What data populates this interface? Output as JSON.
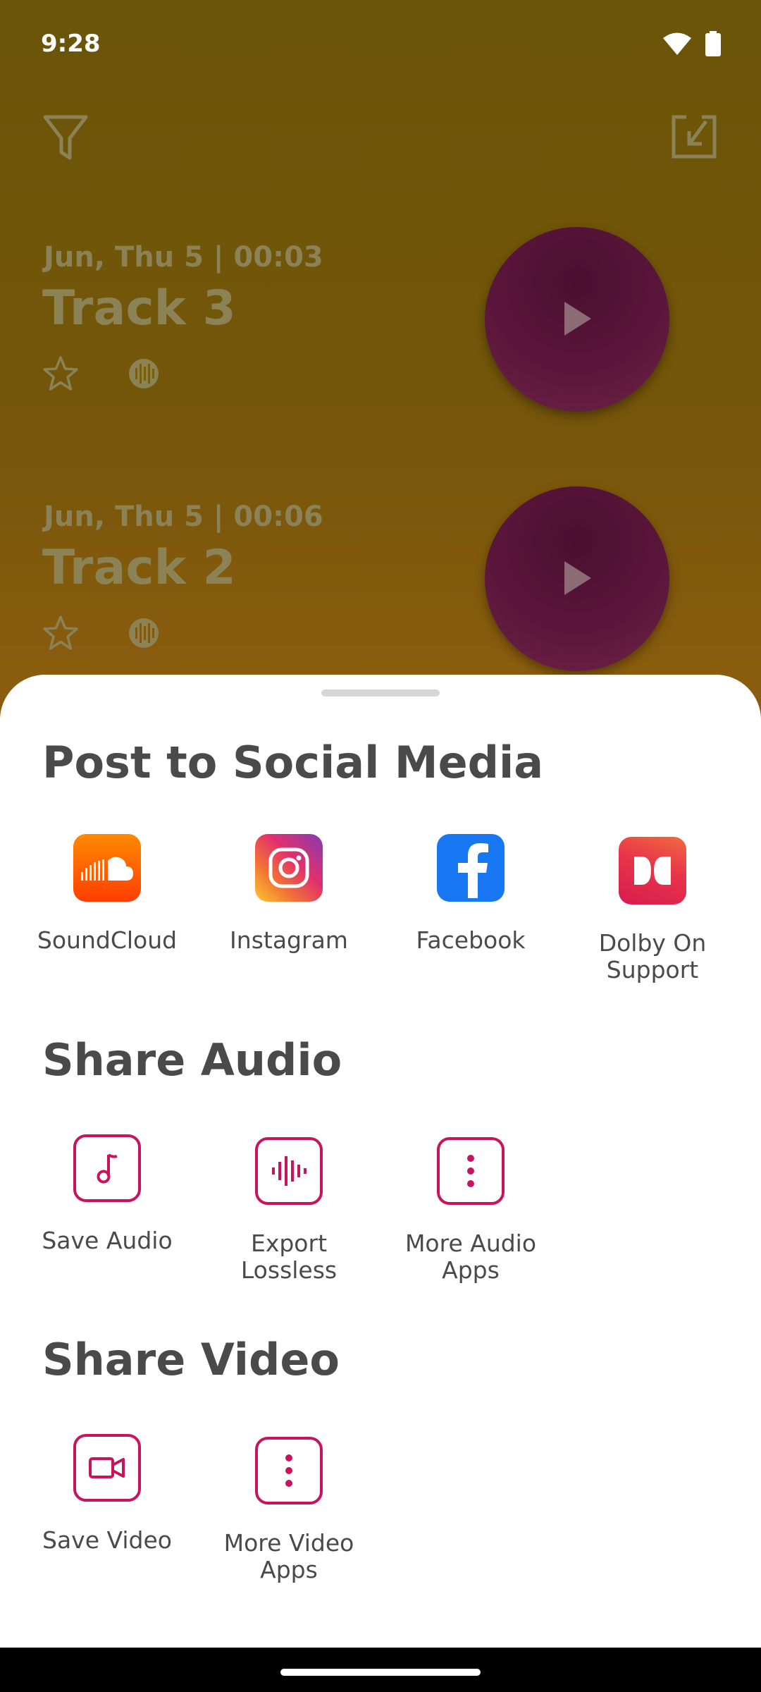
{
  "status_bar": {
    "time": "9:28"
  },
  "tracks": [
    {
      "meta": "Jun, Thu 5 | 00:03",
      "title": "Track 3"
    },
    {
      "meta": "Jun, Thu 5 | 00:06",
      "title": "Track 2"
    }
  ],
  "share_sheet": {
    "social": {
      "title": "Post to Social Media",
      "items": [
        {
          "label": "SoundCloud",
          "icon": "soundcloud-icon",
          "color": "#ff5500"
        },
        {
          "label": "Instagram",
          "icon": "instagram-icon",
          "color": "#c13584"
        },
        {
          "label": "Facebook",
          "icon": "facebook-icon",
          "color": "#1877f2"
        },
        {
          "label": "Dolby On\nSupport",
          "icon": "dolby-icon",
          "color": "#e0283a"
        }
      ]
    },
    "audio": {
      "title": "Share Audio",
      "items": [
        {
          "label": "Save Audio",
          "icon": "music-note-icon"
        },
        {
          "label": "Export\nLossless",
          "icon": "waveform-icon"
        },
        {
          "label": "More Audio\nApps",
          "icon": "more-vertical-icon"
        }
      ]
    },
    "video": {
      "title": "Share Video",
      "items": [
        {
          "label": "Save Video",
          "icon": "video-camera-icon"
        },
        {
          "label": "More Video\nApps",
          "icon": "more-vertical-icon"
        }
      ]
    }
  },
  "colors": {
    "accent": "#c8135f",
    "text": "#4a4a4a"
  }
}
